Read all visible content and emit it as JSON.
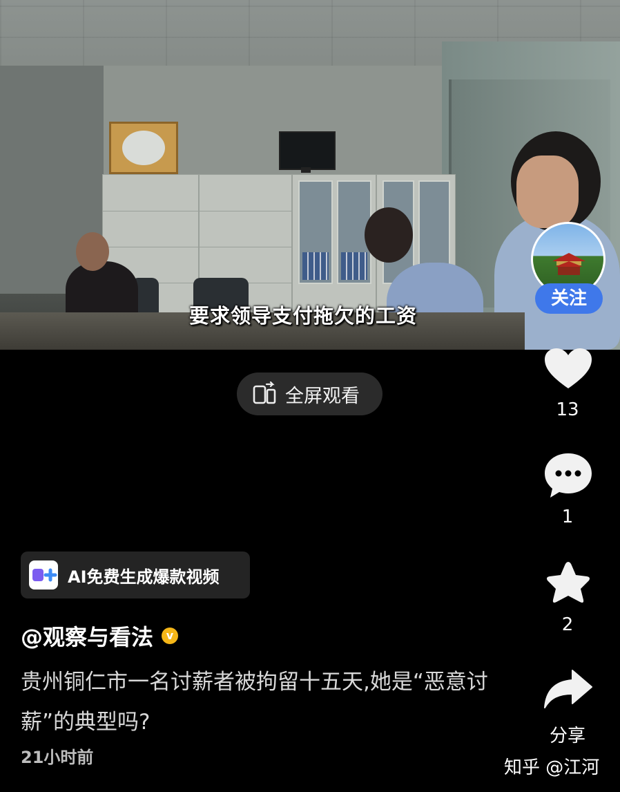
{
  "video": {
    "subtitle": "要求领导支付拖欠的工资"
  },
  "follow_button": "关注",
  "fullscreen_button": {
    "label": "全屏观看",
    "icon": "fullscreen-rotate-icon"
  },
  "actions": {
    "like": {
      "icon": "heart-icon",
      "count": "13"
    },
    "comment": {
      "icon": "comment-icon",
      "count": "1"
    },
    "favorite": {
      "icon": "star-icon",
      "count": "2"
    },
    "share": {
      "icon": "share-icon",
      "label": "分享"
    }
  },
  "ai_banner": {
    "label": "AI免费生成爆款视频",
    "icon": "ai-video-logo-icon"
  },
  "post": {
    "author": "@观察与看法",
    "verified_badge": "v",
    "description": "贵州铜仁市一名讨薪者被拘留十五天,她是“恶意讨薪”的典型吗?",
    "time": "21小时前"
  },
  "watermark": "知乎 @江河",
  "colors": {
    "background": "#000000",
    "follow": "#3f78ea",
    "badge": "#f5b618"
  }
}
